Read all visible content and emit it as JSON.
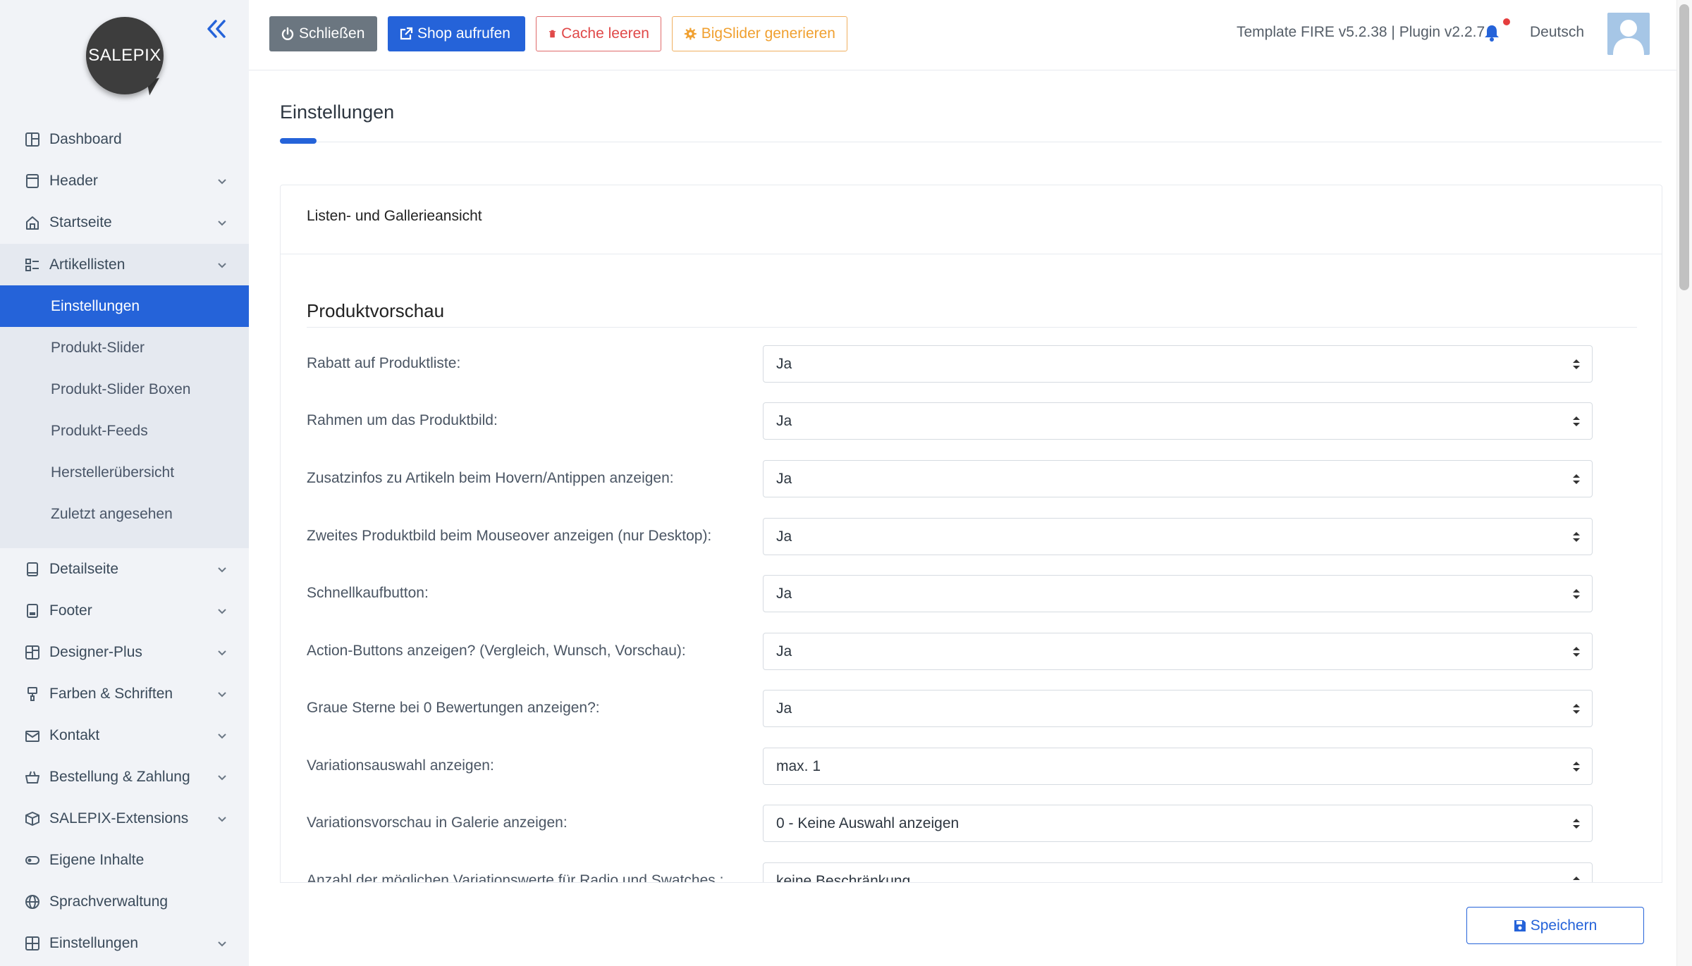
{
  "sidebar": {
    "logo_text": "SALEPIX",
    "collapse_icon": "double-chevron-left-icon",
    "items": [
      {
        "label": "Dashboard",
        "icon": "dashboard-icon"
      },
      {
        "label": "Header",
        "icon": "header-icon"
      },
      {
        "label": "Startseite",
        "icon": "home-icon"
      },
      {
        "label": "Artikellisten",
        "icon": "list-icon"
      },
      {
        "label": "Detailseite",
        "icon": "detail-icon"
      },
      {
        "label": "Footer",
        "icon": "footer-icon"
      },
      {
        "label": "Designer-Plus",
        "icon": "designer-icon"
      },
      {
        "label": "Farben & Schriften",
        "icon": "brush-icon"
      },
      {
        "label": "Kontakt",
        "icon": "mail-icon"
      },
      {
        "label": "Bestellung & Zahlung",
        "icon": "basket-icon"
      },
      {
        "label": "SALEPIX-Extensions",
        "icon": "package-icon"
      },
      {
        "label": "Eigene Inhalte",
        "icon": "toggle-icon"
      },
      {
        "label": "Sprachverwaltung",
        "icon": "globe-icon"
      },
      {
        "label": "Einstellungen",
        "icon": "settings-grid-icon"
      }
    ],
    "subitems": [
      {
        "label": "Einstellungen",
        "active": true
      },
      {
        "label": "Produkt-Slider"
      },
      {
        "label": "Produkt-Slider Boxen"
      },
      {
        "label": "Produkt-Feeds"
      },
      {
        "label": "Herstellerübersicht"
      },
      {
        "label": "Zuletzt angesehen"
      }
    ]
  },
  "topbar": {
    "close_label": "Schließen",
    "shop_label": "Shop aufrufen",
    "cache_label": "Cache leeren",
    "slider_label": "BigSlider generieren",
    "version": "Template FIRE v5.2.38 | Plugin v2.2.7",
    "language": "Deutsch"
  },
  "main": {
    "page_title": "Einstellungen",
    "card_header": "Listen- und Gallerieansicht",
    "section_title": "Produktvorschau",
    "fields": [
      {
        "label": "Rabatt auf Produktliste:",
        "value": "Ja"
      },
      {
        "label": "Rahmen um das Produktbild:",
        "value": "Ja"
      },
      {
        "label": "Zusatzinfos zu Artikeln beim Hovern/Antippen anzeigen:",
        "value": "Ja"
      },
      {
        "label": "Zweites Produktbild beim Mouseover anzeigen (nur Desktop):",
        "value": "Ja"
      },
      {
        "label": "Schnellkaufbutton:",
        "value": "Ja"
      },
      {
        "label": "Action-Buttons anzeigen? (Vergleich, Wunsch, Vorschau):",
        "value": "Ja"
      },
      {
        "label": "Graue Sterne bei 0 Bewertungen anzeigen?:",
        "value": "Ja"
      },
      {
        "label": "Variationsauswahl anzeigen:",
        "value": "max. 1"
      },
      {
        "label": "Variationsvorschau in Galerie anzeigen:",
        "value": "0 - Keine Auswahl anzeigen"
      },
      {
        "label": "Anzahl der möglichen Variationswerte für Radio und Swatches :",
        "value": "keine Beschränkung"
      }
    ],
    "save_label": "Speichern"
  },
  "colors": {
    "accent": "#2563d9",
    "danger": "#e04848",
    "warning": "#f0a030",
    "secondary": "#6b7680"
  }
}
